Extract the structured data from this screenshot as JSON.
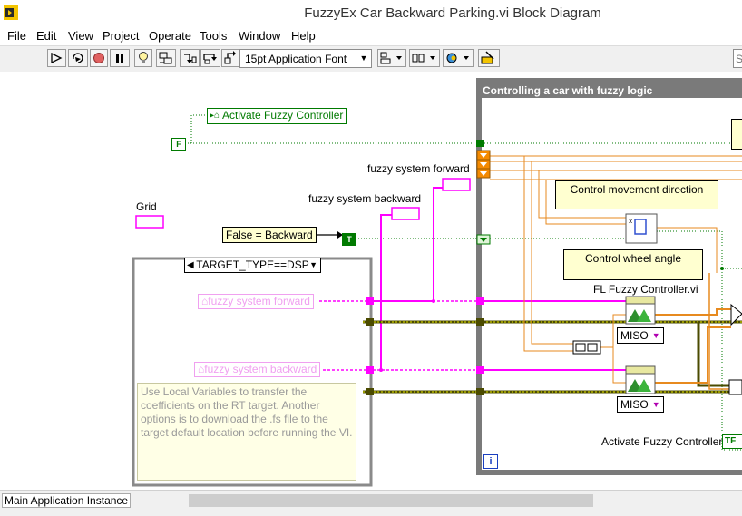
{
  "window": {
    "title": "FuzzyEx Car Backward Parking.vi Block Diagram"
  },
  "menu": [
    "File",
    "Edit",
    "View",
    "Project",
    "Operate",
    "Tools",
    "Window",
    "Help"
  ],
  "toolbar": {
    "font": "15pt Application Font",
    "search_placeholder": "Se"
  },
  "diagram": {
    "activate_control_label": "Activate Fuzzy Controller",
    "false_constant": "F",
    "true_constant": "T",
    "grid_label": "Grid",
    "fs_forward_label": "fuzzy system forward",
    "fs_backward_label": "fuzzy system backward",
    "false_backward_comment": "False = Backward",
    "case_selector": "TARGET_TYPE==DSP",
    "local_var_forward": "fuzzy system forward",
    "local_var_backward": "fuzzy system backward",
    "case_comment": "Use Local Variables to transfer the coefficients on the RT target. Another options is to download the .fs file to the target default location before running the VI.",
    "loop_title": "Controlling a car with fuzzy logic",
    "movement_comment": "Control movement direction",
    "wheel_comment": "Control wheel angle",
    "fl_controller_label": "FL Fuzzy Controller.vi",
    "miso_1": "MISO",
    "miso_2": "MISO",
    "activate_indicator_label": "Activate Fuzzy Controller",
    "tf_indicator": "TF",
    "iteration_terminal": "i"
  },
  "status": {
    "instance": "Main Application Instance"
  },
  "colors": {
    "boolean_wire": "#007a00",
    "cluster_wire": "#ff00ff",
    "refnum_wire": "#4b4b00",
    "numeric_wire": "#e78a1f",
    "loop_border": "#7a7a7a"
  }
}
